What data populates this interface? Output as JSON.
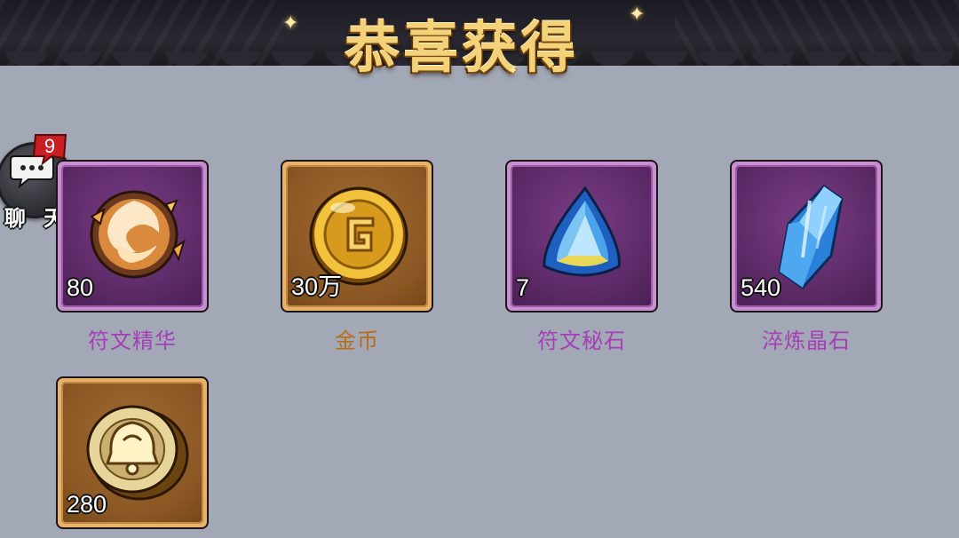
{
  "header": {
    "title": "恭喜获得"
  },
  "chat": {
    "label": "聊 天",
    "badge_count": "9"
  },
  "items": [
    {
      "name": "符文精华",
      "quantity": "80",
      "rarity": "purple",
      "icon": "rune-essence-icon"
    },
    {
      "name": "金币",
      "quantity": "30万",
      "rarity": "gold",
      "icon": "gold-coin-icon"
    },
    {
      "name": "符文秘石",
      "quantity": "7",
      "rarity": "purple",
      "icon": "rune-secret-stone-icon"
    },
    {
      "name": "淬炼晶石",
      "quantity": "540",
      "rarity": "purple",
      "icon": "tempering-crystal-icon"
    },
    {
      "name": "",
      "quantity": "280",
      "rarity": "gold",
      "icon": "bell-coin-icon"
    }
  ],
  "colors": {
    "background": "#a3a8b6",
    "purple_name": "#a43fb7",
    "gold_name": "#b86d15",
    "title_gold": "#f3d27a"
  }
}
